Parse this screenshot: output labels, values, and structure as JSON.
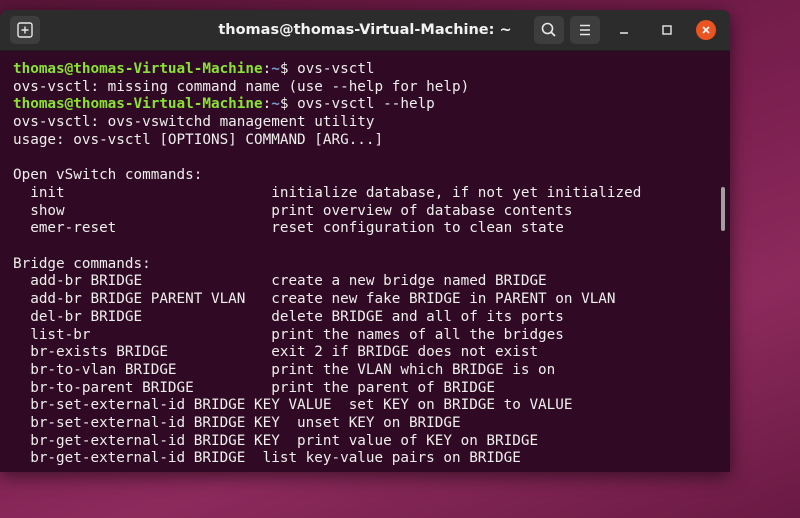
{
  "window": {
    "title": "thomas@thomas-Virtual-Machine: ~"
  },
  "icons": {
    "new_tab": "new-tab-icon",
    "search": "search-icon",
    "menu": "hamburger-menu-icon",
    "minimize": "minimize-icon",
    "maximize": "maximize-icon",
    "close": "close-icon"
  },
  "colors": {
    "terminal_bg": "#300a24",
    "prompt_user": "#8ae234",
    "prompt_path": "#729fcf",
    "close_button": "#e95420"
  },
  "prompt": {
    "user_host": "thomas@thomas-Virtual-Machine",
    "path": "~"
  },
  "terminal": {
    "lines": [
      {
        "type": "prompt",
        "command": "ovs-vsctl"
      },
      {
        "type": "output",
        "text": "ovs-vsctl: missing command name (use --help for help)"
      },
      {
        "type": "prompt",
        "command": "ovs-vsctl --help"
      },
      {
        "type": "output",
        "text": "ovs-vsctl: ovs-vswitchd management utility"
      },
      {
        "type": "output",
        "text": "usage: ovs-vsctl [OPTIONS] COMMAND [ARG...]"
      },
      {
        "type": "output",
        "text": ""
      },
      {
        "type": "output",
        "text": "Open vSwitch commands:"
      },
      {
        "type": "output",
        "text": "  init                        initialize database, if not yet initialized"
      },
      {
        "type": "output",
        "text": "  show                        print overview of database contents"
      },
      {
        "type": "output",
        "text": "  emer-reset                  reset configuration to clean state"
      },
      {
        "type": "output",
        "text": ""
      },
      {
        "type": "output",
        "text": "Bridge commands:"
      },
      {
        "type": "output",
        "text": "  add-br BRIDGE               create a new bridge named BRIDGE"
      },
      {
        "type": "output",
        "text": "  add-br BRIDGE PARENT VLAN   create new fake BRIDGE in PARENT on VLAN"
      },
      {
        "type": "output",
        "text": "  del-br BRIDGE               delete BRIDGE and all of its ports"
      },
      {
        "type": "output",
        "text": "  list-br                     print the names of all the bridges"
      },
      {
        "type": "output",
        "text": "  br-exists BRIDGE            exit 2 if BRIDGE does not exist"
      },
      {
        "type": "output",
        "text": "  br-to-vlan BRIDGE           print the VLAN which BRIDGE is on"
      },
      {
        "type": "output",
        "text": "  br-to-parent BRIDGE         print the parent of BRIDGE"
      },
      {
        "type": "output",
        "text": "  br-set-external-id BRIDGE KEY VALUE  set KEY on BRIDGE to VALUE"
      },
      {
        "type": "output",
        "text": "  br-set-external-id BRIDGE KEY  unset KEY on BRIDGE"
      },
      {
        "type": "output",
        "text": "  br-get-external-id BRIDGE KEY  print value of KEY on BRIDGE"
      },
      {
        "type": "output",
        "text": "  br-get-external-id BRIDGE  list key-value pairs on BRIDGE"
      }
    ]
  }
}
